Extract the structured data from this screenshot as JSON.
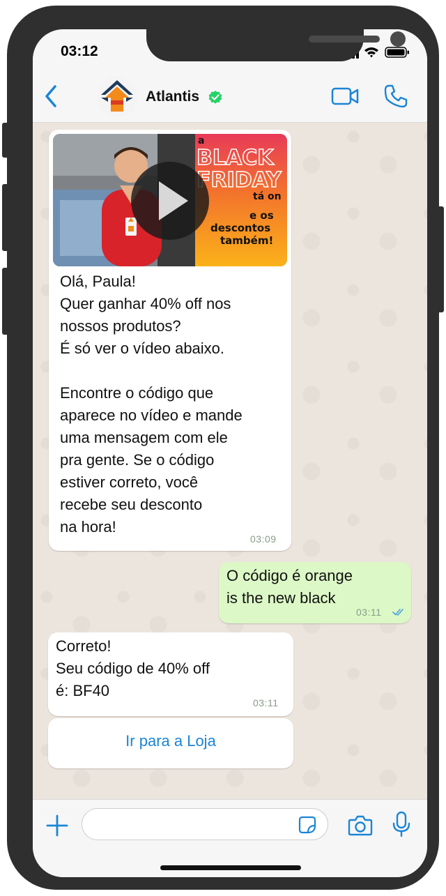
{
  "status_bar": {
    "time": "03:12"
  },
  "header": {
    "contact_name": "Atlantis"
  },
  "messages": {
    "m1": {
      "image_text": {
        "a": "a",
        "black": "BLACK",
        "friday": "FRIDAY",
        "taon": "tá on",
        "line1": "e os",
        "line2": "descontos",
        "line3": "também!"
      },
      "text": "Olá, Paula!\nQuer ganhar 40% off nos\nnossos produtos?\nÉ só ver o vídeo abaixo.\n\nEncontre o código que\naparece no vídeo e mande\numa mensagem com ele\npra gente. Se o código\nestiver correto, você\nrecebe seu desconto\nna hora!",
      "time": "03:09"
    },
    "m2": {
      "text": "O código é orange\nis the new black",
      "time": "03:11"
    },
    "m3": {
      "text": "Correto!\nSeu código de 40% off\né: BF40",
      "time": "03:11"
    },
    "m4": {
      "button_label": "Ir para a Loja"
    }
  },
  "colors": {
    "accent": "#1a85d6",
    "outgoing_bubble": "#dcf8c6",
    "verified": "#25d366",
    "chat_bg": "#ece5dd"
  }
}
